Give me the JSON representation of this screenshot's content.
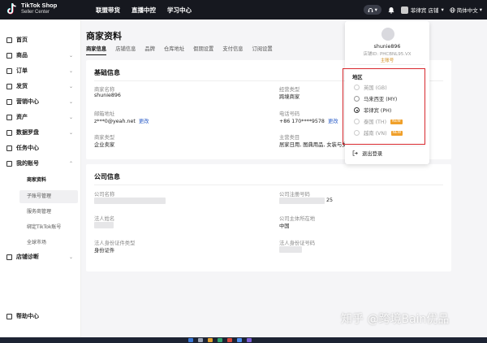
{
  "brand": {
    "line1": "TikTok Shop",
    "line2": "Seller Center"
  },
  "topnav": [
    "联盟带货",
    "直播中控",
    "学习中心"
  ],
  "topbar": {
    "support_icon": "headset-icon",
    "user": "菲律宾 店铺",
    "language": "简体中文"
  },
  "sidebar": {
    "items": [
      {
        "label": "首页",
        "icon": "home-icon"
      },
      {
        "label": "商品",
        "icon": "box-icon"
      },
      {
        "label": "订单",
        "icon": "order-icon"
      },
      {
        "label": "发货",
        "icon": "truck-icon"
      },
      {
        "label": "营销中心",
        "icon": "megaphone-icon"
      },
      {
        "label": "资产",
        "icon": "wallet-icon"
      },
      {
        "label": "数据罗盘",
        "icon": "chart-icon"
      },
      {
        "label": "任务中心",
        "icon": "task-icon"
      },
      {
        "label": "我的账号",
        "icon": "user-icon"
      }
    ],
    "subitems": [
      "商家资料",
      "子账号管理",
      "服务商管理",
      "绑定TikTok账号",
      "全球市场"
    ],
    "bottom_items": [
      {
        "label": "店铺诊断",
        "icon": "diagnosis-icon"
      },
      {
        "label": "帮助中心",
        "icon": "help-icon"
      }
    ]
  },
  "page": {
    "title": "商家资料",
    "tabs": [
      "商家信息",
      "店铺信息",
      "品牌",
      "仓库地址",
      "假期设置",
      "支付信息",
      "订阅设置"
    ],
    "basic": {
      "title": "基础信息",
      "fields": [
        {
          "label": "商家名称",
          "value": "shunie896"
        },
        {
          "label": "经营类型",
          "value": "跨境商家"
        },
        {
          "label": "邮箱地址",
          "value": "z***0@yeah.net",
          "link": "更改"
        },
        {
          "label": "电话号码",
          "value": "+86 170****9578",
          "link": "更改"
        },
        {
          "label": "商家类型",
          "value": "企业卖家"
        },
        {
          "label": "主营类目",
          "value": "居家日用, 图典用品, 女装与女"
        }
      ]
    },
    "company": {
      "title": "公司信息",
      "fields": [
        {
          "label": "公司名称",
          "value": ""
        },
        {
          "label": "公司注册号码",
          "value": "25"
        },
        {
          "label": "法人姓名",
          "value": ""
        },
        {
          "label": "公司主体所在地",
          "value": "中国"
        },
        {
          "label": "法人身份证件类型",
          "value": "身份证件"
        },
        {
          "label": "法人身份证号码",
          "value": ""
        }
      ]
    }
  },
  "account_menu": {
    "name": "shunie896",
    "id": "店铺ID: PHCBNL95.VX",
    "badge": "主账号",
    "region_label": "地区",
    "regions": [
      {
        "label": "英国 (GB)",
        "state": "disabled",
        "tag": ""
      },
      {
        "label": "马来西亚 (MY)",
        "state": "off",
        "tag": ""
      },
      {
        "label": "菲律宾 (PH)",
        "state": "selected",
        "tag": ""
      },
      {
        "label": "泰国 (TH)",
        "state": "disabled",
        "tag": "NEW"
      },
      {
        "label": "越南 (VN)",
        "state": "disabled",
        "tag": "NEW"
      }
    ],
    "logout": "退出登录",
    "highlight_color": "#d8272d"
  },
  "watermark": "知乎 @跨境Bain优品"
}
